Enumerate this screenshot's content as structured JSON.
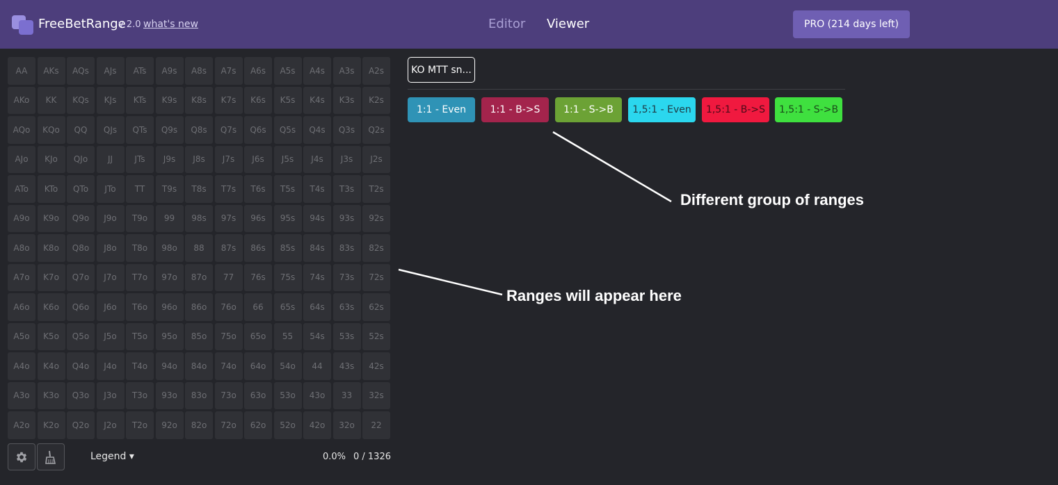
{
  "header": {
    "brand": "FreeBetRange",
    "version": "v 2.0",
    "whats_new": "what's new",
    "nav": {
      "editor": "Editor",
      "viewer": "Viewer"
    },
    "pro_button": "PRO (214 days left)"
  },
  "grid": [
    [
      "AA",
      "AKs",
      "AQs",
      "AJs",
      "ATs",
      "A9s",
      "A8s",
      "A7s",
      "A6s",
      "A5s",
      "A4s",
      "A3s",
      "A2s"
    ],
    [
      "AKo",
      "KK",
      "KQs",
      "KJs",
      "KTs",
      "K9s",
      "K8s",
      "K7s",
      "K6s",
      "K5s",
      "K4s",
      "K3s",
      "K2s"
    ],
    [
      "AQo",
      "KQo",
      "QQ",
      "QJs",
      "QTs",
      "Q9s",
      "Q8s",
      "Q7s",
      "Q6s",
      "Q5s",
      "Q4s",
      "Q3s",
      "Q2s"
    ],
    [
      "AJo",
      "KJo",
      "QJo",
      "JJ",
      "JTs",
      "J9s",
      "J8s",
      "J7s",
      "J6s",
      "J5s",
      "J4s",
      "J3s",
      "J2s"
    ],
    [
      "ATo",
      "KTo",
      "QTo",
      "JTo",
      "TT",
      "T9s",
      "T8s",
      "T7s",
      "T6s",
      "T5s",
      "T4s",
      "T3s",
      "T2s"
    ],
    [
      "A9o",
      "K9o",
      "Q9o",
      "J9o",
      "T9o",
      "99",
      "98s",
      "97s",
      "96s",
      "95s",
      "94s",
      "93s",
      "92s"
    ],
    [
      "A8o",
      "K8o",
      "Q8o",
      "J8o",
      "T8o",
      "98o",
      "88",
      "87s",
      "86s",
      "85s",
      "84s",
      "83s",
      "82s"
    ],
    [
      "A7o",
      "K7o",
      "Q7o",
      "J7o",
      "T7o",
      "97o",
      "87o",
      "77",
      "76s",
      "75s",
      "74s",
      "73s",
      "72s"
    ],
    [
      "A6o",
      "K6o",
      "Q6o",
      "J6o",
      "T6o",
      "96o",
      "86o",
      "76o",
      "66",
      "65s",
      "64s",
      "63s",
      "62s"
    ],
    [
      "A5o",
      "K5o",
      "Q5o",
      "J5o",
      "T5o",
      "95o",
      "85o",
      "75o",
      "65o",
      "55",
      "54s",
      "53s",
      "52s"
    ],
    [
      "A4o",
      "K4o",
      "Q4o",
      "J4o",
      "T4o",
      "94o",
      "84o",
      "74o",
      "64o",
      "54o",
      "44",
      "43s",
      "42s"
    ],
    [
      "A3o",
      "K3o",
      "Q3o",
      "J3o",
      "T3o",
      "93o",
      "83o",
      "73o",
      "63o",
      "53o",
      "43o",
      "33",
      "32s"
    ],
    [
      "A2o",
      "K2o",
      "Q2o",
      "J2o",
      "T2o",
      "92o",
      "82o",
      "72o",
      "62o",
      "52o",
      "42o",
      "32o",
      "22"
    ]
  ],
  "footer": {
    "legend": "Legend ▾",
    "percent": "0.0%",
    "combos": "0 / 1326",
    "settings_icon": "gear-icon",
    "clear_icon": "broom-icon"
  },
  "range_tab": "KO MTT sn...",
  "groups": [
    {
      "label": "1:1 - Even",
      "color": "#2f93b6",
      "text_color": "#ffffff"
    },
    {
      "label": "1:1 - B->S",
      "color": "#a3244c",
      "text_color": "#ffffff"
    },
    {
      "label": "1:1 - S->B",
      "color": "#6ca235",
      "text_color": "#ffffff"
    },
    {
      "label": "1,5:1 - Even",
      "color": "#2bd7ee",
      "text_color": "#1f3a44"
    },
    {
      "label": "1,5:1 - B->S",
      "color": "#f0193f",
      "text_color": "#4a0a18"
    },
    {
      "label": "1,5:1 - S->B",
      "color": "#3fe03f",
      "text_color": "#1a4a1a"
    }
  ],
  "annotations": {
    "groups_note": "Different group of ranges",
    "ranges_note": "Ranges will appear here"
  },
  "colors": {
    "header_bg": "#4d3e7c",
    "page_bg": "#24252a",
    "cell_bg": "#303136",
    "pro_button": "#6f5fb3"
  }
}
